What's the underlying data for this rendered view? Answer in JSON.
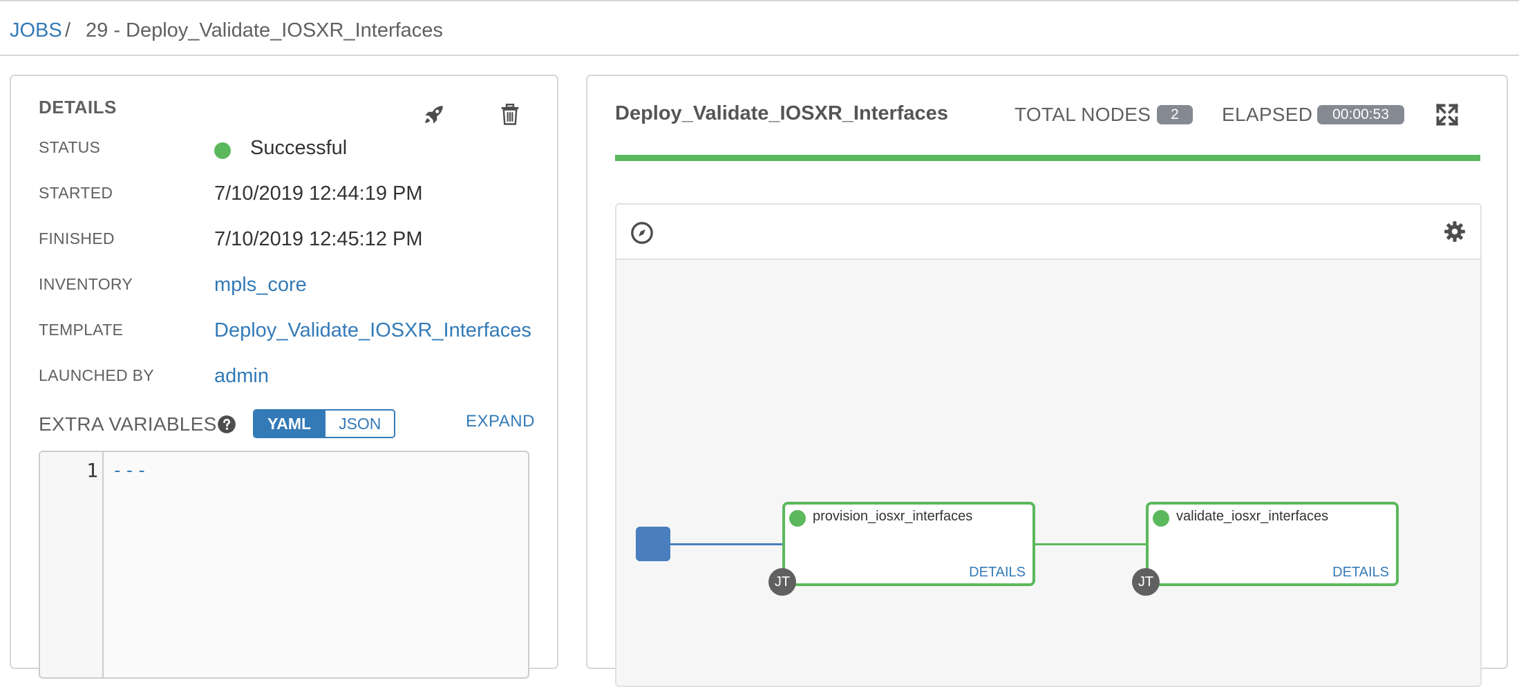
{
  "breadcrumb": {
    "jobs_link": "JOBS",
    "separator": "/",
    "current": "29 - Deploy_Validate_IOSXR_Interfaces"
  },
  "details": {
    "heading": "DETAILS",
    "status_label": "STATUS",
    "status_value": "Successful",
    "started_label": "STARTED",
    "started_value": "7/10/2019 12:44:19 PM",
    "finished_label": "FINISHED",
    "finished_value": "7/10/2019 12:45:12 PM",
    "inventory_label": "INVENTORY",
    "inventory_value": "mpls_core",
    "template_label": "TEMPLATE",
    "template_value": "Deploy_Validate_IOSXR_Interfaces",
    "launched_by_label": "LAUNCHED BY",
    "launched_by_value": "admin",
    "extra_vars_label": "EXTRA VARIABLES",
    "yaml_label": "YAML",
    "json_label": "JSON",
    "expand_label": "EXPAND",
    "code": {
      "line_number": "1",
      "line_text": "---"
    },
    "icons": {
      "launch": "rocket-icon",
      "delete": "trash-icon",
      "help": "question-circle-icon"
    }
  },
  "workflow": {
    "title": "Deploy_Validate_IOSXR_Interfaces",
    "total_nodes_label": "TOTAL NODES",
    "total_nodes_value": "2",
    "elapsed_label": "ELAPSED",
    "elapsed_value": "00:00:53",
    "progress_percent": 100,
    "nodes": [
      {
        "name": "provision_iosxr_interfaces",
        "details_label": "DETAILS",
        "type_badge": "JT",
        "status": "successful"
      },
      {
        "name": "validate_iosxr_interfaces",
        "details_label": "DETAILS",
        "type_badge": "JT",
        "status": "successful"
      }
    ],
    "icons": {
      "fullscreen": "expand-arrows-icon",
      "compass": "compass-icon",
      "settings": "gear-icon"
    }
  },
  "colors": {
    "link": "#337ab7",
    "success": "#5cb85c",
    "start_node": "#4a7ebf",
    "badge": "#848992"
  }
}
